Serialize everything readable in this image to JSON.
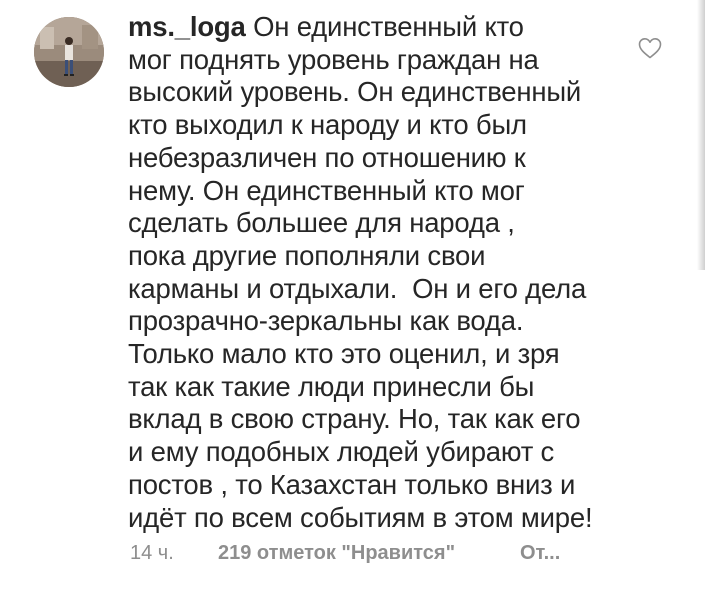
{
  "comment": {
    "username": "ms._loga",
    "lines": [
      "Он единственный кто",
      "мог поднять уровень граждан на",
      "высокий уровень. Он единственный",
      "кто выходил к народу и кто был",
      "небезразличен по отношению к",
      "нему. Он единственный кто мог",
      "сделать большее для народа ,",
      "пока другие пополняли свои",
      "карманы и отдыхали.  Он и его дела",
      "прозрачно-зеркальны как вода.",
      "Только мало кто это оценил, и зря",
      "так как такие люди принесли бы",
      "вклад в свою страну. Но, так как его",
      "и ему подобных людей убирают с",
      "постов , то Казахстан только вниз и",
      "идёт по всем событиям в этом мире!"
    ],
    "time": "14 ч.",
    "likes": "219 отметок \"Нравится\"",
    "reply": "От..."
  },
  "icons": {
    "like": "heart-outline-icon",
    "avatar": "user-avatar"
  },
  "colors": {
    "text": "#262626",
    "meta": "#8e8e8e",
    "background": "#ffffff"
  }
}
